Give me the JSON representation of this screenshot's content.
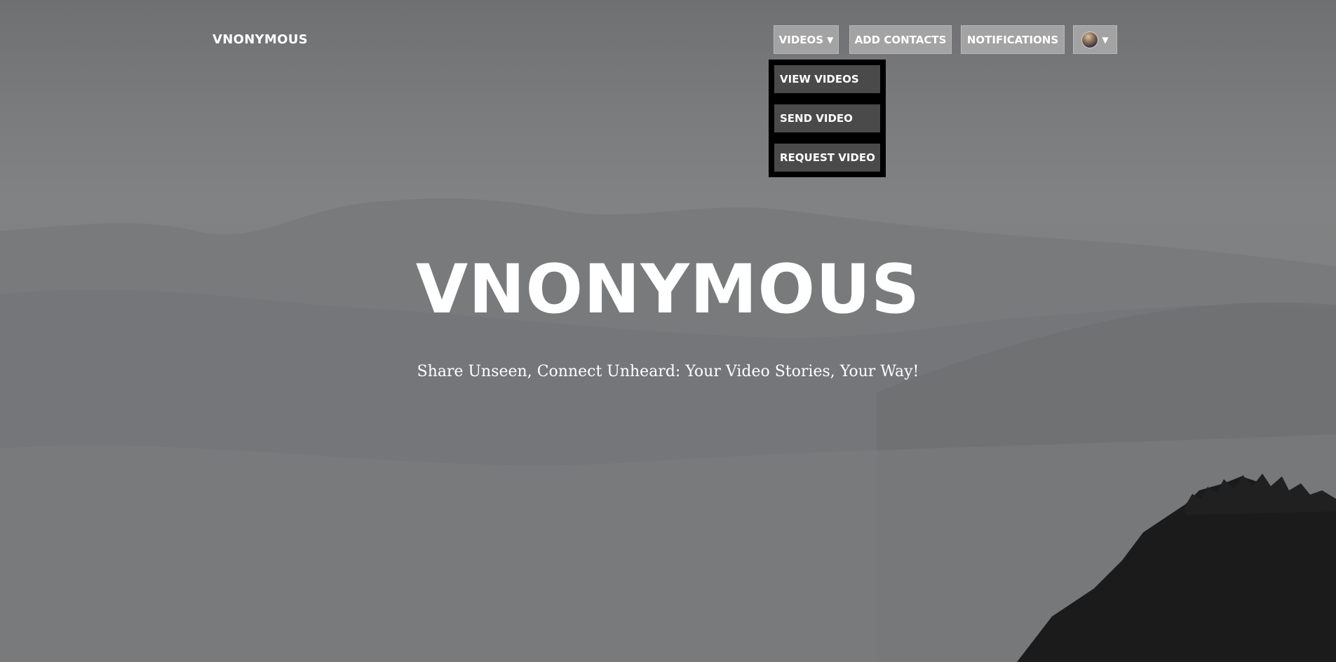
{
  "brand": {
    "name": "VNONYMOUS"
  },
  "nav": {
    "videos_label": "VIDEOS",
    "add_contacts_label": "ADD CONTACTS",
    "notifications_label": "NOTIFICATIONS",
    "caret_icon": "caret-down-icon",
    "profile_icon": "avatar"
  },
  "videos_menu": {
    "items": [
      {
        "label": "VIEW VIDEOS"
      },
      {
        "label": "SEND VIDEO"
      },
      {
        "label": "REQUEST VIDEO"
      }
    ]
  },
  "hero": {
    "title": "VNONYMOUS",
    "subtitle": "Share Unseen, Connect Unheard: Your Video Stories, Your Way!"
  },
  "colors": {
    "nav_button_bg": "#a3a3a3",
    "dropdown_bg": "#000000",
    "dropdown_item_bg": "#4a4a4a",
    "text": "#ffffff"
  }
}
